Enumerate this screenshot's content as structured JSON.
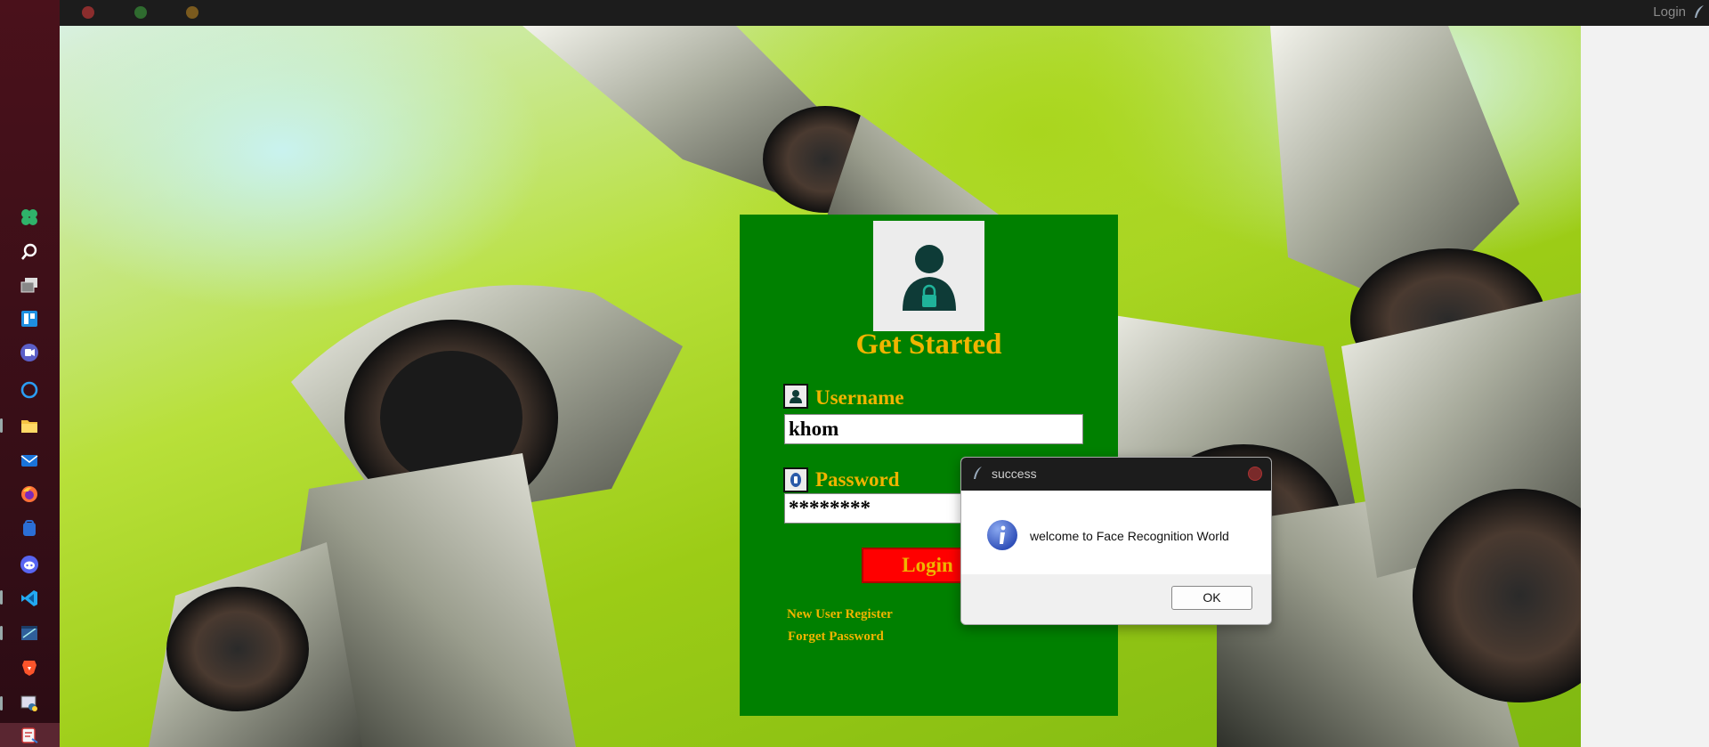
{
  "window": {
    "title": "Login",
    "traffic_lights": [
      "#8b2d2d",
      "#2f6b2f",
      "#7a5a1e"
    ]
  },
  "taskbar": {
    "icons": [
      "widgets-icon",
      "search-icon",
      "task-view-icon",
      "widgets-board-icon",
      "teams-chat-icon",
      "cortana-icon",
      "file-explorer-icon",
      "mail-icon",
      "firefox-icon",
      "app-store-icon",
      "discord-icon",
      "vscode-icon",
      "devtools-icon",
      "brave-icon",
      "python-idle-icon",
      "active-app-icon"
    ]
  },
  "login": {
    "heading": "Get Started",
    "username_label": "Username",
    "username_value": "khom",
    "password_label": "Password",
    "password_value": "********",
    "login_button": "Login",
    "register_link": "New User Register",
    "forgot_link": "Forget Password",
    "colors": {
      "panel": "#008000",
      "accent": "#f0b400",
      "button": "#ff0000"
    }
  },
  "dialog": {
    "title": "success",
    "message": "welcome to Face Recognition World",
    "ok_label": "OK",
    "icon": "info-icon"
  }
}
